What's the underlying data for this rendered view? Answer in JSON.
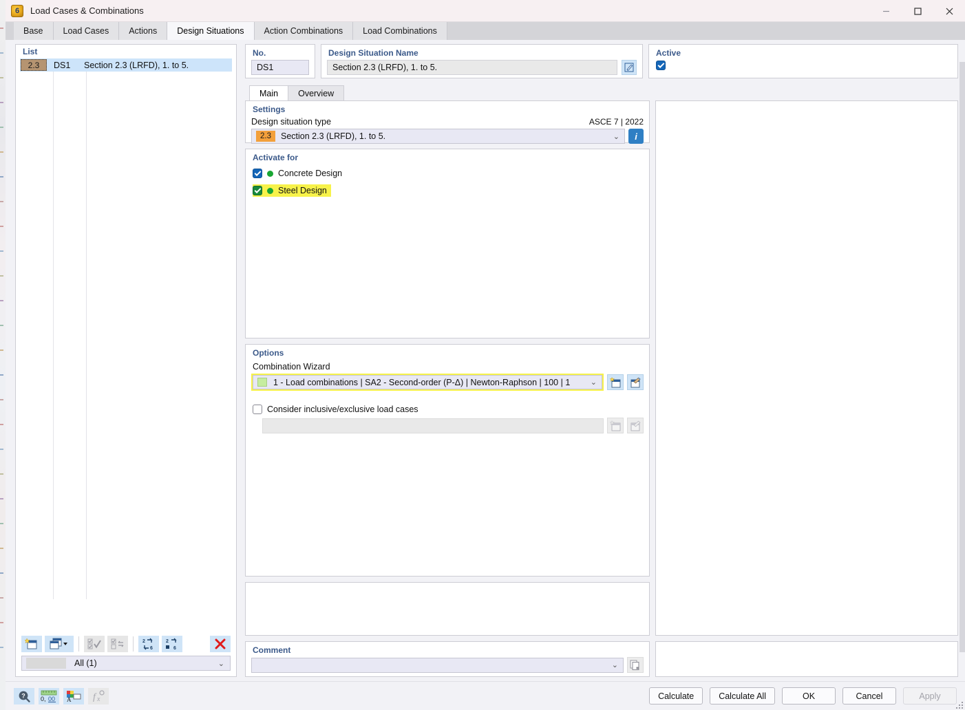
{
  "window": {
    "title": "Load Cases & Combinations",
    "app_icon": "dlubal-orange-icon",
    "controls": {
      "minimize": "–",
      "maximize": "☐",
      "close": "✕"
    }
  },
  "tabs": [
    {
      "label": "Base",
      "active": false
    },
    {
      "label": "Load Cases",
      "active": false
    },
    {
      "label": "Actions",
      "active": false
    },
    {
      "label": "Design Situations",
      "active": true
    },
    {
      "label": "Action Combinations",
      "active": false
    },
    {
      "label": "Load Combinations",
      "active": false
    }
  ],
  "list_panel": {
    "header": "List",
    "row": {
      "badge": "2.3",
      "code": "DS1",
      "name": "Section 2.3 (LRFD), 1. to 5."
    },
    "toolbar": [
      {
        "name": "new-item-button",
        "icon": "new-window-star-icon",
        "disabled": false
      },
      {
        "name": "duplicate-item-button",
        "icon": "copy-windows-icon",
        "disabled": false,
        "has_caret": true
      },
      {
        "name": "select-all-button",
        "icon": "checklist-check-icon",
        "disabled": true
      },
      {
        "name": "invert-selection-button",
        "icon": "checklist-swap-icon",
        "disabled": true
      },
      {
        "name": "renumber-button",
        "icon": "renumber-arrows-icon",
        "disabled": false
      },
      {
        "name": "sort-button",
        "icon": "sort-numbers-icon",
        "disabled": false
      },
      {
        "name": "delete-item-button",
        "icon": "red-x-icon",
        "disabled": false
      }
    ],
    "filter": {
      "label": "All (1)",
      "caret": "⌄"
    }
  },
  "header_fields": {
    "no": {
      "label": "No.",
      "value": "DS1"
    },
    "design_situation_name": {
      "label": "Design Situation Name",
      "value": "Section 2.3 (LRFD), 1. to 5.",
      "edit_icon": "edit-pencil-icon"
    },
    "active": {
      "label": "Active",
      "checked": true
    }
  },
  "inner_tabs": [
    {
      "label": "Main",
      "active": true
    },
    {
      "label": "Overview",
      "active": false
    }
  ],
  "settings": {
    "group_title": "Settings",
    "design_situation_type_label": "Design situation type",
    "standard": "ASCE 7 | 2022",
    "selected": {
      "badge": "2.3",
      "text": "Section 2.3 (LRFD), 1. to 5."
    },
    "caret": "⌄",
    "info_icon": "info-circle-icon",
    "info_letter": "i"
  },
  "activate_for": {
    "group_title": "Activate for",
    "items": [
      {
        "label": "Concrete Design",
        "checked": true,
        "highlighted": false,
        "check_color": "#1466b8",
        "dot_color": "#19a633"
      },
      {
        "label": "Steel Design",
        "checked": true,
        "highlighted": true,
        "check_color": "#1a8a3c",
        "dot_color": "#19a633"
      }
    ]
  },
  "options": {
    "group_title": "Options",
    "combination_wizard_label": "Combination Wizard",
    "combination_wizard_value": "1 - Load combinations | SA2 - Second-order (P-Δ) | Newton-Raphson | 100 | 1",
    "combination_wizard_swatch": "#c6eda0",
    "caret": "⌄",
    "new_button_icon": "new-window-star-icon",
    "edit_button_icon": "edit-window-icon",
    "consider_label": "Consider inclusive/exclusive load cases",
    "consider_checked": false,
    "consider_value": "",
    "consider_new_icon": "new-window-star-icon",
    "consider_edit_icon": "edit-window-icon"
  },
  "comment": {
    "group_title": "Comment",
    "value": "",
    "caret": "⌄",
    "button_icon": "copy-pages-icon"
  },
  "footer": {
    "tools": [
      {
        "name": "help-button",
        "icon": "question-magnifier-icon",
        "disabled": false
      },
      {
        "name": "units-button",
        "icon": "decimal-units-icon",
        "label": "0,00",
        "disabled": false
      },
      {
        "name": "display-properties-button",
        "icon": "color-palette-icon",
        "disabled": false
      },
      {
        "name": "formula-button",
        "icon": "fx-formula-icon",
        "label": "fx",
        "disabled": true
      }
    ],
    "buttons": [
      {
        "label": "Calculate",
        "disabled": false
      },
      {
        "label": "Calculate All",
        "disabled": false
      },
      {
        "label": "OK",
        "disabled": false
      },
      {
        "label": "Cancel",
        "disabled": false
      },
      {
        "label": "Apply",
        "disabled": true
      }
    ]
  },
  "colors": {
    "highlight_yellow": "#f7f24a",
    "accent_blue": "#1466b8",
    "group_title_blue": "#3c5a8a",
    "badge_orange": "#f3a03b",
    "badge_brown": "#b59471",
    "selection_blue": "#cde4fa",
    "green_check": "#1a8a3c"
  }
}
